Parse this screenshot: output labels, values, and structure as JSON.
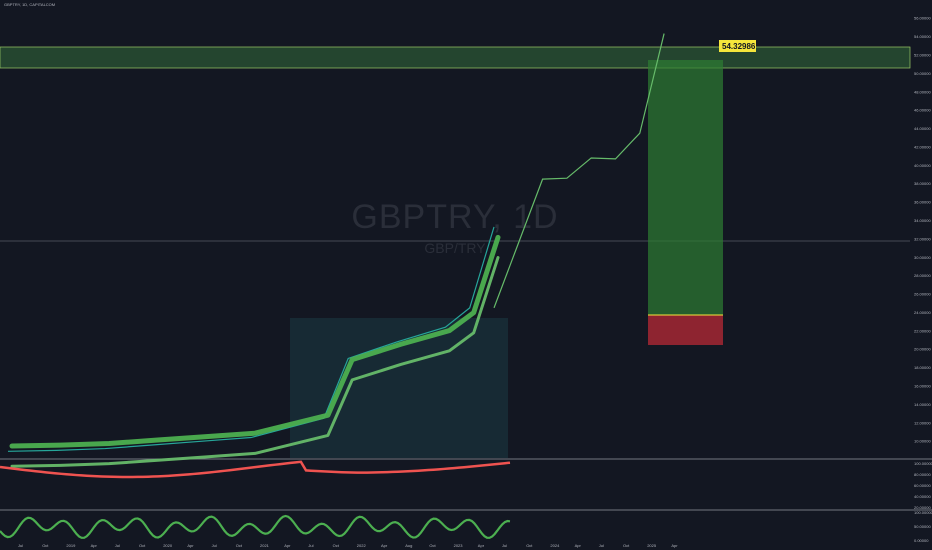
{
  "header": {
    "title": "GBPTRY, 1D, CAPITALCOM"
  },
  "watermark": {
    "symbol": "GBPTRY, 1D",
    "description": "GBP/TRY"
  },
  "target_label": "54.32986",
  "price_axis": [
    "56.00000",
    "54.00000",
    "52.00000",
    "50.00000",
    "48.00000",
    "46.00000",
    "44.00000",
    "42.00000",
    "40.00000",
    "38.00000",
    "36.00000",
    "34.00000",
    "32.00000",
    "30.00000",
    "28.00000",
    "26.00000",
    "24.00000",
    "22.00000",
    "20.00000",
    "18.00000",
    "16.00000",
    "14.00000",
    "12.00000",
    "10.00000"
  ],
  "ind1_axis": [
    "100.00000",
    "80.00000",
    "60.00000",
    "40.00000",
    "20.00000"
  ],
  "ind2_axis": [
    "100.00000",
    "50.00000",
    "0.00000"
  ],
  "time_axis": [
    "Jul",
    "Oct",
    "2019",
    "Apr",
    "Jul",
    "Oct",
    "2020",
    "Apr",
    "Jul",
    "Oct",
    "2021",
    "Apr",
    "Jul",
    "Oct",
    "2022",
    "Apr",
    "Aug",
    "Oct",
    "2023",
    "Apr",
    "Jul",
    "Oct",
    "2024",
    "Apr",
    "Jul",
    "Oct",
    "2025",
    "Apr"
  ],
  "colors": {
    "background": "#131722",
    "up": "#26a69a",
    "down": "#ef5350",
    "projection": "#66bb6a",
    "zone": "#4caf50",
    "target_bg": "#f5e63b",
    "stop": "#c62828"
  },
  "chart_data": {
    "type": "line",
    "title": "GBPTRY, 1D, CAPITALCOM",
    "ylim": [
      8.5,
      57
    ],
    "y_scale": "linear",
    "x": [
      "2018-07",
      "2019-01",
      "2019-07",
      "2020-01",
      "2020-07",
      "2021-01",
      "2021-07",
      "2021-10",
      "2022-01",
      "2022-07",
      "2023-01",
      "2023-04",
      "2023-07"
    ],
    "series": [
      {
        "values": [
          8.9,
          9.0,
          9.2,
          9.6,
          10.0,
          10.4,
          11.8,
          12.5,
          19.0,
          20.8,
          22.4,
          24.5,
          33.3
        ]
      }
    ],
    "projection_a": {
      "x": [
        "2023-07",
        "2023-10",
        "2024-01",
        "2024-04",
        "2024-07",
        "2024-10",
        "2025-01",
        "2025-04"
      ],
      "y": [
        24.5,
        31.5,
        38.5,
        38.6,
        40.8,
        40.7,
        43.5,
        54.33
      ]
    },
    "target_price": 54.32986,
    "resistance_zone": [
      52.5,
      55.0
    ],
    "position": {
      "entry": 25.0,
      "stop": 21.6,
      "target": 54.33
    }
  }
}
